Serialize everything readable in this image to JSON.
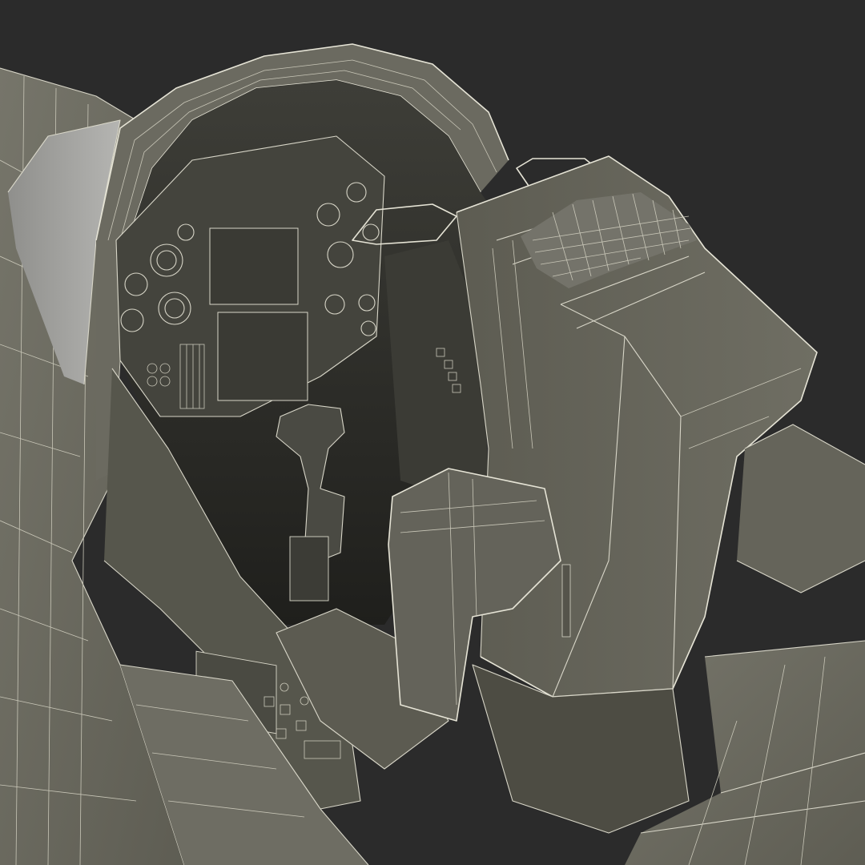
{
  "scene": {
    "subject": "cockpit-wireframe-render",
    "colors": {
      "background": "#2b2b2b",
      "hull": "#6a6a60",
      "hull_light": "#7c7b70",
      "hull_dark": "#545449",
      "interior": "#3a3a34",
      "interior_dark": "#262622",
      "wire": "#d8d6c8",
      "canopy_glass": "#a9a9a6"
    }
  }
}
